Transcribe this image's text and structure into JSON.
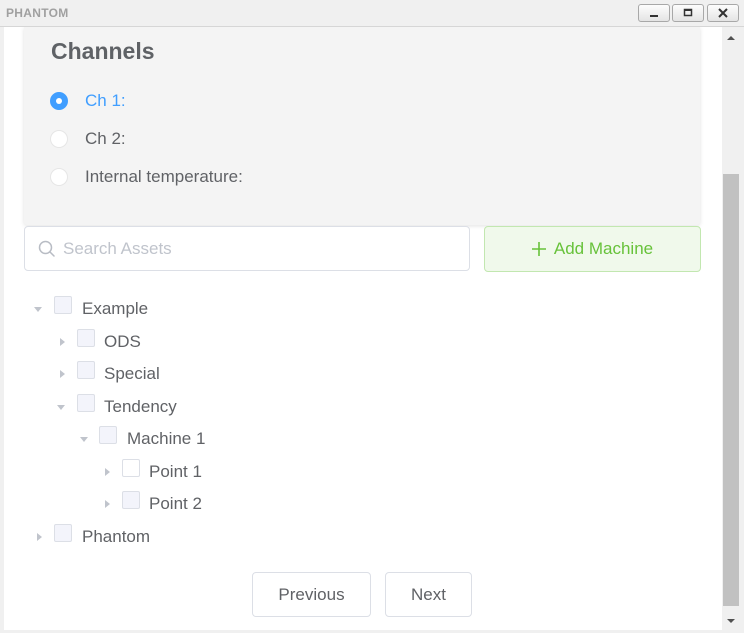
{
  "window": {
    "title": "PHANTOM"
  },
  "channels": {
    "title": "Channels",
    "options": [
      {
        "label": "Ch 1:",
        "checked": true
      },
      {
        "label": "Ch 2:",
        "checked": false
      },
      {
        "label": "Internal temperature:",
        "checked": false
      }
    ]
  },
  "search": {
    "placeholder": "Search Assets",
    "value": ""
  },
  "add_machine": {
    "label": "Add Machine"
  },
  "tree": [
    {
      "label": "Example",
      "expanded": true
    },
    {
      "label": "ODS",
      "expanded": false
    },
    {
      "label": "Special",
      "expanded": false
    },
    {
      "label": "Tendency",
      "expanded": true
    },
    {
      "label": "Machine 1",
      "expanded": true
    },
    {
      "label": "Point 1",
      "expanded": false
    },
    {
      "label": "Point 2",
      "expanded": false
    },
    {
      "label": "Phantom",
      "expanded": false
    }
  ],
  "nav": {
    "previous": "Previous",
    "next": "Next"
  },
  "colors": {
    "accent": "#409eff",
    "success": "#67c23a",
    "text": "#606266"
  }
}
